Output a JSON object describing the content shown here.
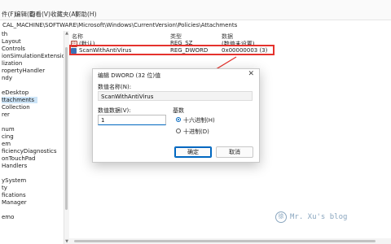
{
  "menu": [
    "件(F)",
    "编辑(E)",
    "查看(V)",
    "收藏夹(A)",
    "帮助(H)"
  ],
  "address": "CAL_MACHINE\\SOFTWARE\\Microsoft\\Windows\\CurrentVersion\\Policies\\Attachments",
  "tree_items": [
    "th",
    "Layout",
    "Controls",
    "ionSimulationExtensions",
    "lization",
    "ropertyHandler",
    "ndy",
    "",
    "",
    "eDesktop",
    "ttachments",
    "Collection",
    "rer",
    "",
    "num",
    "cing",
    "em",
    "ficiencyDiagnostics",
    "onTouchPad",
    "Handlers",
    "",
    "ySystem",
    "ty",
    "fications",
    "Manager",
    "",
    "emo"
  ],
  "columns": {
    "name": "名称",
    "type": "类型",
    "data": "数据"
  },
  "rows": [
    {
      "name": "(默认)",
      "type": "REG_SZ",
      "data": "(数值未设置)",
      "icon": "ab-icon"
    },
    {
      "name": "ScanWithAntiVirus",
      "type": "REG_DWORD",
      "data": "0x00000003 (3)",
      "icon": "dword-icon"
    }
  ],
  "dialog": {
    "title": "编辑 DWORD (32 位)值",
    "close": "✕",
    "name_label": "数值名称(N):",
    "name_value": "ScanWithAntiVirus",
    "data_label": "数值数据(V):",
    "data_value": "1",
    "base_label": "基数",
    "hex_label": "十六进制(H)",
    "dec_label": "十进制(D)",
    "ok": "确定",
    "cancel": "取消"
  },
  "watermark": "Mr. Xu's blog",
  "watermark_icon": "徐",
  "accent": "#e5322d"
}
